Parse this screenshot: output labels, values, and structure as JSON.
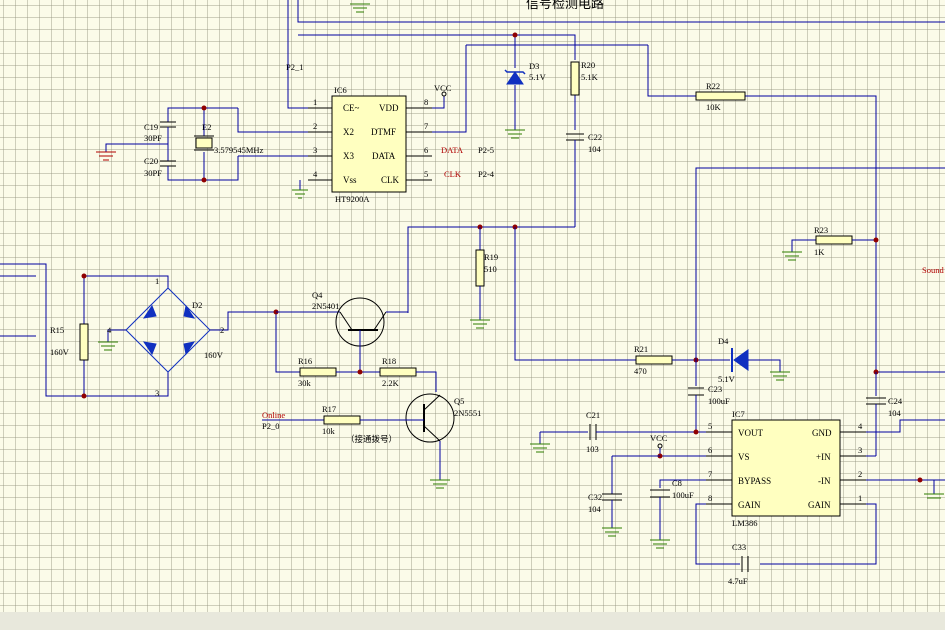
{
  "header": {
    "title": "信号检测电路"
  },
  "ht9200": {
    "ref": "IC6",
    "part": "HT9200A",
    "pin_names_left": [
      "CE~",
      "X2",
      "X3",
      "Vss"
    ],
    "pin_names_right": [
      "VDD",
      "DTMF",
      "DATA",
      "CLK"
    ],
    "pin_nums_left": [
      "1",
      "2",
      "3",
      "4"
    ],
    "pin_nums_right": [
      "8",
      "7",
      "6",
      "5"
    ]
  },
  "lm386": {
    "ref": "IC7",
    "part": "LM386",
    "pin_names_left": [
      "VOUT",
      "VS",
      "BYPASS",
      "GAIN"
    ],
    "pin_names_right": [
      "GND",
      "+IN",
      "-IN",
      "GAIN"
    ],
    "pin_nums_left": [
      "5",
      "6",
      "7",
      "8"
    ],
    "pin_nums_right": [
      "4",
      "3",
      "2",
      "1"
    ]
  },
  "labels": {
    "p2_1": "P2_1",
    "vcc1": "VCC",
    "vcc2": "VCC",
    "data_net": "DATA",
    "clk_net": "CLK",
    "p2_5": "P2-5",
    "p2_4": "P2-4",
    "online": "Online",
    "p2_0": "P2_0",
    "sound": "Sound",
    "d2_pin1": "1",
    "d2_pin2": "2",
    "d2_pin3": "3",
    "d2_pin4": "4",
    "connect_note": "（接通拨号）"
  },
  "components": {
    "c19": "C19",
    "c19v": "30PF",
    "c20": "C20",
    "c20v": "30PF",
    "e2": "E2",
    "e2v": "3.579545MHz",
    "d3": "D3",
    "d3v": "5.1V",
    "r20": "R20",
    "r20v": "5.1K",
    "c22": "C22",
    "c22v": "104",
    "r22": "R22",
    "r22v": "10K",
    "r15": "R15",
    "r15v": "160V",
    "d2": "D2",
    "d2v": "160V",
    "q4": "Q4",
    "q4v": "2N5401",
    "r19": "R19",
    "r19v": "510",
    "r16": "R16",
    "r16v": "30k",
    "r18": "R18",
    "r18v": "2.2K",
    "q5": "Q5",
    "q5v": "2N5551",
    "r17": "R17",
    "r17v": "10k",
    "r23": "R23",
    "r23v": "1K",
    "r21": "R21",
    "r21v": "470",
    "d4": "D4",
    "d4v": "5.1V",
    "c23": "C23",
    "c23v": "100uF",
    "c24": "C24",
    "c24v": "104",
    "c21": "C21",
    "c21v": "103",
    "c32": "C32",
    "c32v": "104",
    "c8": "C8",
    "c8v": "100uF",
    "c33": "C33",
    "c33v": "4.7uF"
  },
  "colors": {
    "wire": "#0000a0",
    "body": "#ffffc0",
    "junction": "#900000",
    "ground": "#2e7d00",
    "grid_bg": "#fbfbe9"
  }
}
